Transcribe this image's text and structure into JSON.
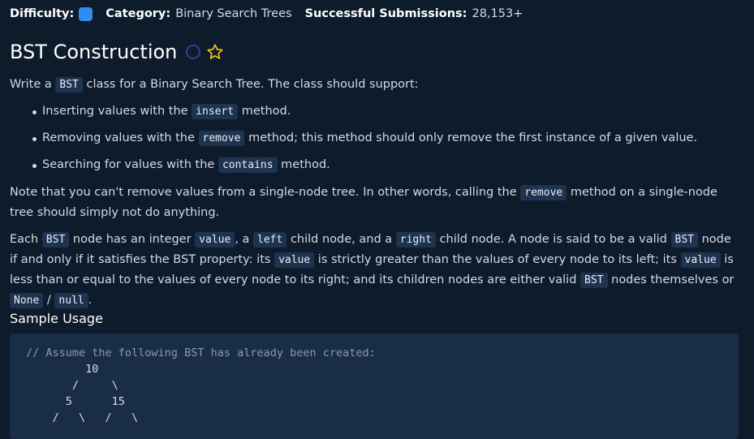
{
  "header": {
    "difficulty_label": "Difficulty:",
    "category_label": "Category:",
    "category_value": "Binary Search Trees",
    "submissions_label": "Successful Submissions:",
    "submissions_value": "28,153+",
    "difficulty_color": "#2f8cf0"
  },
  "problem": {
    "title": "BST Construction",
    "p1": {
      "a": "Write a ",
      "code": "BST",
      "b": " class for a Binary Search Tree. The class should support:"
    },
    "bullets": [
      {
        "a": "Inserting values with the ",
        "code": "insert",
        "b": " method."
      },
      {
        "a": "Removing values with the ",
        "code": "remove",
        "b": " method; this method should only remove the first instance of a given value."
      },
      {
        "a": "Searching for values with the ",
        "code": "contains",
        "b": " method."
      }
    ],
    "p2": {
      "a": "Note that you can't remove values from a single-node tree. In other words, calling the ",
      "code": "remove",
      "b": " method on a single-node tree should simply not do anything."
    },
    "p3": {
      "t1": "Each ",
      "c1": "BST",
      "t2": " node has an integer ",
      "c2": "value",
      "t3": ", a ",
      "c3": "left",
      "t4": " child node, and a ",
      "c4": "right",
      "t5": " child node. A node is said to be a valid ",
      "c5": "BST",
      "t6": " node if and only if it satisfies the BST property: its ",
      "c6": "value",
      "t7": " is strictly greater than the values of every node to its left; its ",
      "c7": "value",
      "t8": " is less than or equal to the values of every node to its right; and its children nodes are either valid ",
      "c8": "BST",
      "t9": " nodes themselves or ",
      "c9": "None",
      "t10": " / ",
      "c10": "null",
      "t11": "."
    }
  },
  "sample": {
    "heading": "Sample Usage",
    "comment": "// Assume the following BST has already been created:",
    "tree_lines": [
      "         10",
      "       /     \\",
      "      5      15",
      "    /   \\   /   \\"
    ]
  }
}
